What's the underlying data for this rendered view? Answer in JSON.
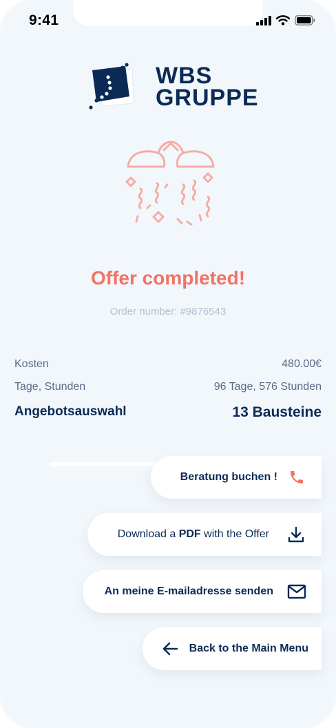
{
  "status": {
    "time": "9:41"
  },
  "logo": {
    "line1": "WBS",
    "line2": "GRUPPE"
  },
  "main": {
    "title": "Offer completed!",
    "order_number": "Order number: #9876543"
  },
  "summary": [
    {
      "label": "Kosten",
      "value": "480.00€"
    },
    {
      "label": "Tage, Stunden",
      "value": "96 Tage, 576 Stunden"
    },
    {
      "label": "Angebotsauswahl",
      "value": "13 Bausteine"
    }
  ],
  "actions": {
    "book": "Beratung buchen !",
    "download_prefix": "Download a ",
    "download_bold": "PDF",
    "download_suffix": " with the Offer",
    "email": "An meine E-mailadresse senden",
    "back": "Back to the Main Menu"
  },
  "colors": {
    "accent": "#f17366",
    "navy": "#0b2a55",
    "background": "#f2f7fc"
  }
}
